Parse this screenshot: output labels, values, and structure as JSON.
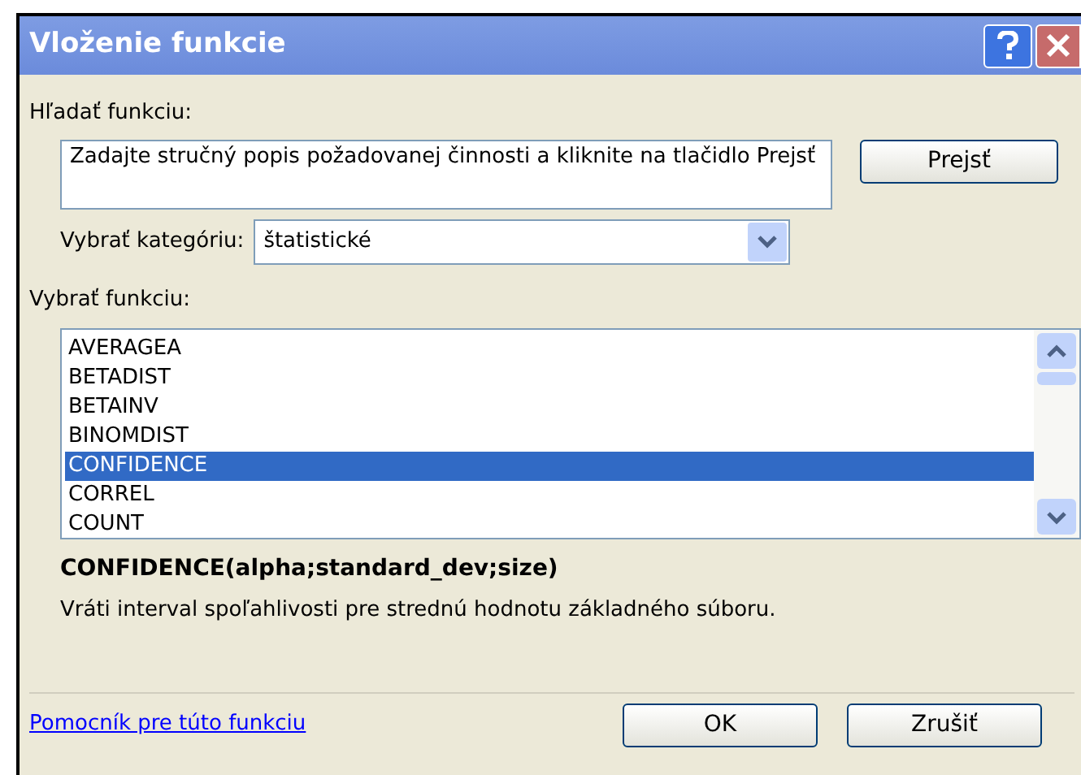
{
  "window": {
    "title": "Vloženie funkcie"
  },
  "search": {
    "label": "Hľadať funkciu:",
    "value": "Zadajte stručný popis požadovanej činnosti a kliknite na tlačidlo Prejsť",
    "button": "Prejsť"
  },
  "category": {
    "label": "Vybrať kategóriu:",
    "value": "štatistické"
  },
  "functions": {
    "label": "Vybrať funkciu:",
    "items": [
      {
        "name": "AVERAGEA",
        "selected": false
      },
      {
        "name": "BETADIST",
        "selected": false
      },
      {
        "name": "BETAINV",
        "selected": false
      },
      {
        "name": "BINOMDIST",
        "selected": false
      },
      {
        "name": "CONFIDENCE",
        "selected": true
      },
      {
        "name": "CORREL",
        "selected": false
      },
      {
        "name": "COUNT",
        "selected": false
      }
    ]
  },
  "signature": "CONFIDENCE(alpha;standard_dev;size)",
  "description": "Vráti interval spoľahlivosti pre strednú hodnotu základného súboru.",
  "help_link": "Pomocník pre túto funkciu",
  "buttons": [
    "OK",
    "Zrušiť"
  ]
}
